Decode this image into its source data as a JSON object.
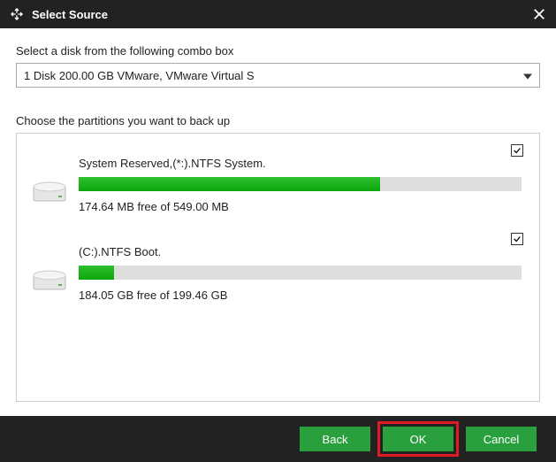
{
  "window": {
    "title": "Select Source"
  },
  "labels": {
    "select_disk": "Select a disk from the following combo box",
    "choose_partitions": "Choose the partitions you want to back up"
  },
  "combo": {
    "selected": "1 Disk 200.00 GB VMware,  VMware Virtual S"
  },
  "partitions": [
    {
      "name": "System Reserved,(*:).NTFS System.",
      "free_text": "174.64 MB free of 549.00 MB",
      "checked": true,
      "fill_percent": 68
    },
    {
      "name": "(C:).NTFS Boot.",
      "free_text": "184.05 GB free of 199.46 GB",
      "checked": true,
      "fill_percent": 8
    }
  ],
  "buttons": {
    "back": "Back",
    "ok": "OK",
    "cancel": "Cancel"
  },
  "colors": {
    "accent_green": "#2a9f3e",
    "bar_fill": "#14b414",
    "highlight_red": "#e01b24",
    "titlebar": "#222222"
  }
}
